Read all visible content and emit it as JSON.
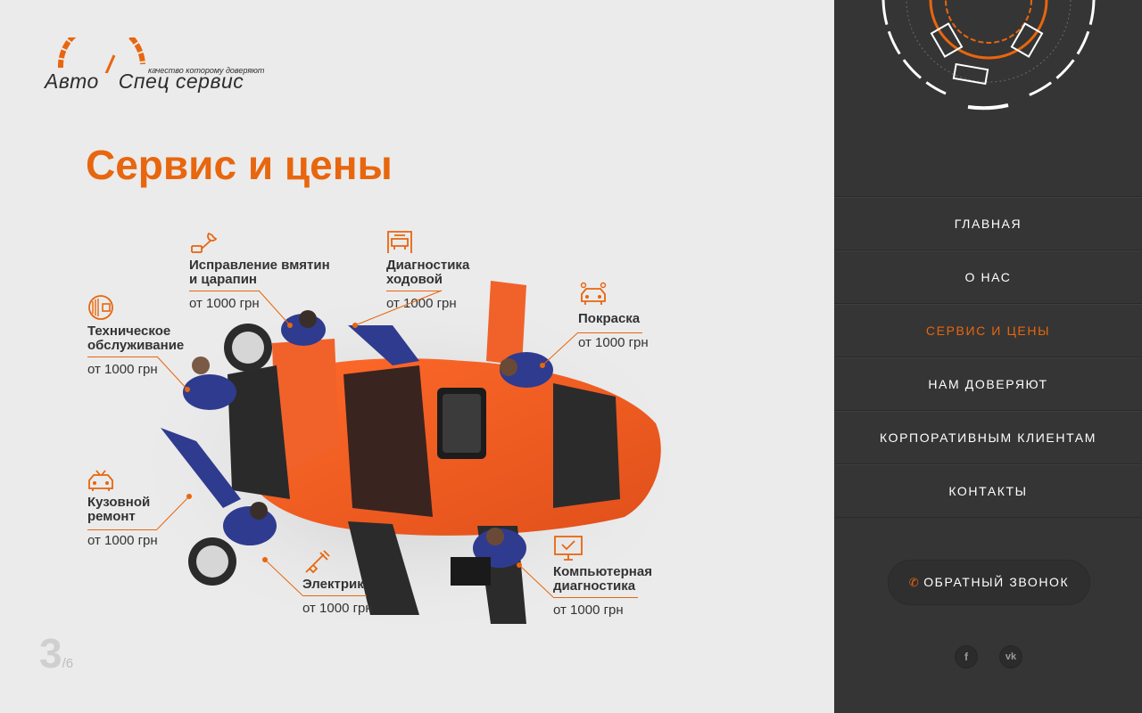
{
  "logo": {
    "word1": "Авто",
    "word2": "Спец сервис",
    "tagline": "качество которому доверяют"
  },
  "page_title": "Сервис и цены",
  "services": [
    {
      "id": "body-repair",
      "icon": "wrench-icon",
      "title": "Исправление вмятин\nи царапин",
      "price": "от 1000 грн"
    },
    {
      "id": "chassis",
      "icon": "car-lift-icon",
      "title": "Диагностика\nходовой",
      "price": "от 1000 грн"
    },
    {
      "id": "maintenance",
      "icon": "tire-icon",
      "title": "Техническое\nобслуживание",
      "price": "от 1000 грн"
    },
    {
      "id": "painting",
      "icon": "car-wash-icon",
      "title": "Покраска",
      "price": "от 1000 грн"
    },
    {
      "id": "bodywork",
      "icon": "car-door-icon",
      "title": "Кузовной\nремонт",
      "price": "от 1000 грн"
    },
    {
      "id": "electric",
      "icon": "spark-plug-icon",
      "title": "Электрик",
      "price": "от 1000 грн"
    },
    {
      "id": "computer",
      "icon": "monitor-check-icon",
      "title": "Компьютерная\nдиагностика",
      "price": "от 1000 грн"
    }
  ],
  "pagination": {
    "current": "3",
    "total": "/6"
  },
  "nav": {
    "items": [
      {
        "label": "Главная",
        "active": false
      },
      {
        "label": "О нас",
        "active": false
      },
      {
        "label": "Сервис и цены",
        "active": true
      },
      {
        "label": "Нам доверяют",
        "active": false
      },
      {
        "label": "Корпоративным клиентам",
        "active": false
      },
      {
        "label": "Контакты",
        "active": false
      }
    ]
  },
  "callback": {
    "label": "ОБРАТНЫЙ ЗВОНОК",
    "icon": "phone-icon"
  },
  "social": [
    {
      "name": "facebook-icon",
      "glyph": "f"
    },
    {
      "name": "vk-icon",
      "glyph": "vk"
    }
  ],
  "colors": {
    "accent": "#e8660e",
    "sidebar": "#353535",
    "background": "#ebebeb",
    "text": "#333333"
  }
}
